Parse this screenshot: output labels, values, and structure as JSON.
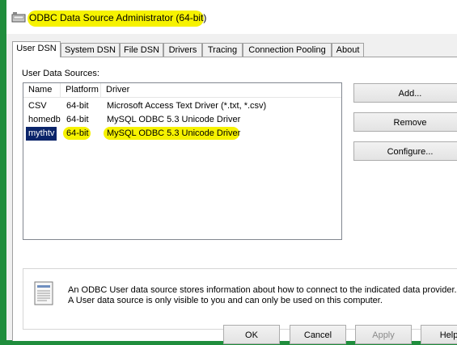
{
  "window": {
    "title": "ODBC Data Source Administrator (64-bit)"
  },
  "tabs": [
    {
      "label": "User DSN",
      "active": true
    },
    {
      "label": "System DSN",
      "active": false
    },
    {
      "label": "File DSN",
      "active": false
    },
    {
      "label": "Drivers",
      "active": false
    },
    {
      "label": "Tracing",
      "active": false
    },
    {
      "label": "Connection Pooling",
      "active": false
    },
    {
      "label": "About",
      "active": false
    }
  ],
  "user_dsn": {
    "section_label": "User Data Sources:",
    "columns": [
      "Name",
      "Platform",
      "Driver"
    ],
    "rows": [
      {
        "name": "CSV",
        "platform": "64-bit",
        "driver": "Microsoft Access Text Driver (*.txt, *.csv)",
        "selected": false
      },
      {
        "name": "homedb",
        "platform": "64-bit",
        "driver": "MySQL ODBC 5.3 Unicode Driver",
        "selected": false
      },
      {
        "name": "mythtv",
        "platform": "64-bit",
        "driver": "MySQL ODBC 5.3 Unicode Driver",
        "selected": true
      }
    ],
    "buttons": {
      "add": "Add...",
      "remove": "Remove",
      "configure": "Configure..."
    },
    "info_text": "An ODBC User data source stores information about how to connect to the indicated data provider.  A User data source is only visible to you and can only be used on this computer."
  },
  "footer": {
    "ok": "OK",
    "cancel": "Cancel",
    "apply": "Apply",
    "help": "Help"
  },
  "icons": {
    "title": "database-icon",
    "info": "document-icon"
  },
  "colors": {
    "highlight": "#f6f200",
    "selection": "#0a246a",
    "desktop": "#1f8d3c"
  }
}
